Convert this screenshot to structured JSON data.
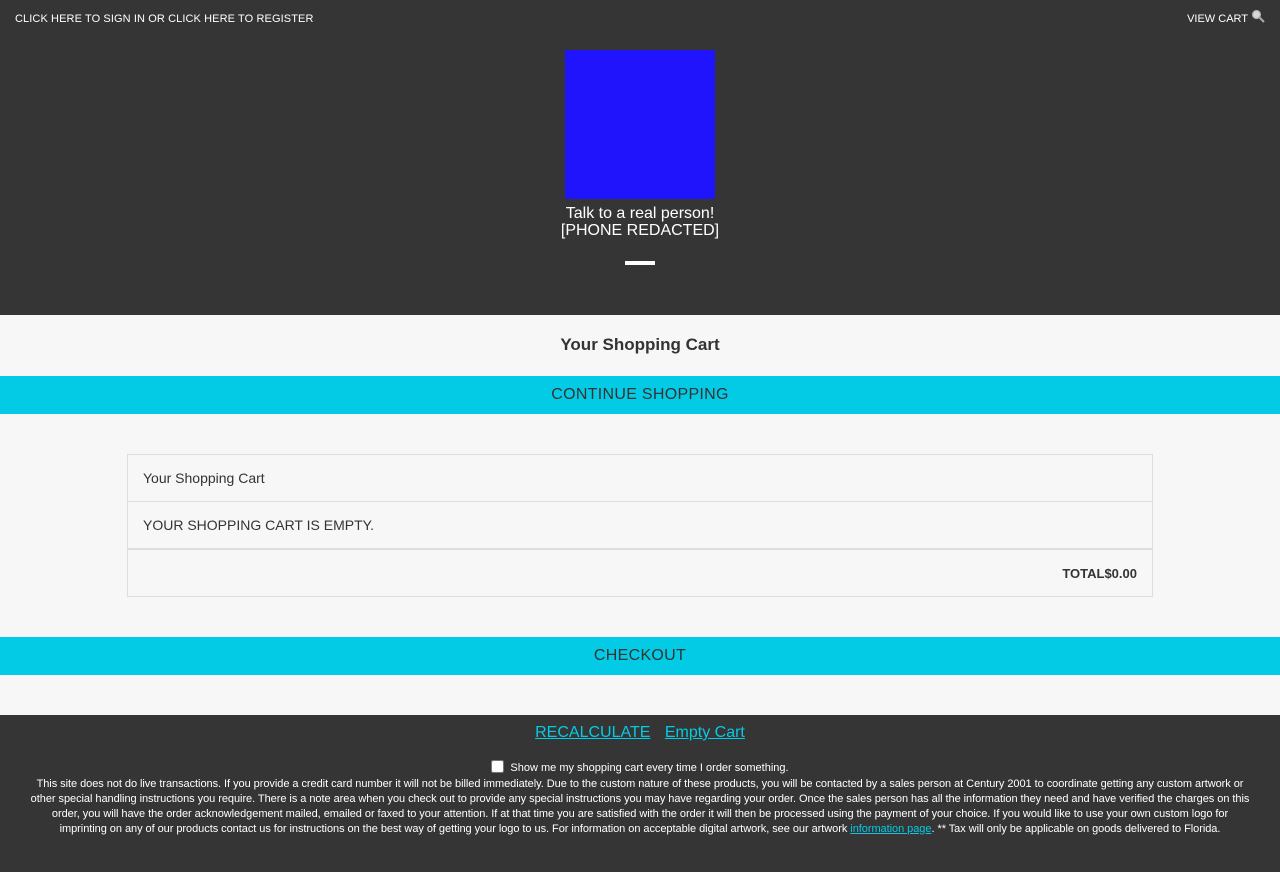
{
  "header": {
    "signin_prefix": "CLICK HERE TO SIGN IN",
    "signin_or": " OR ",
    "register": "CLICK HERE TO REGISTER",
    "view_cart": "VIEW CART",
    "search_icon": "search-icon",
    "logo_color": "#1f14fb",
    "talk_line1": "Talk to a real person!",
    "talk_line2": "[PHONE REDACTED]"
  },
  "main": {
    "title": "Your Shopping Cart",
    "continue_label": "CONTINUE SHOPPING",
    "checkout_label": "CHECKOUT",
    "accent_color": "#04cbe5"
  },
  "cart_table": {
    "caption": "Your Shopping Cart",
    "empty_message": "YOUR SHOPPING CART IS EMPTY.",
    "total_label": "TOTAL",
    "total_value": "$0.00"
  },
  "footer": {
    "recalculate": "RECALCULATE",
    "empty_cart": "Empty Cart",
    "show_cart_label": "Show me my shopping cart every time I order something.",
    "show_cart_checked": false,
    "disclaimer_text": "This site does not do live transactions. If you provide a credit card number it will not be billed immediately. Due to the custom nature of these products, you will be contacted by a sales person at Century 2001 to coordinate getting any custom artwork or other special handling instructions you require. There is a note area when you check out to provide any special instructions you may have regarding your order. Once the sales person has all the information they need and have verified the charges on this order, you will have the order acknowledgement mailed, emailed or faxed to your attention. If at that time you are satisfied with the order it will then be processed using the payment of your choice. If you would like to use your own custom logo for imprinting on any of our products contact us for instructions on the best way of getting your logo to us. For information on acceptable digital artwork, see our artwork ",
    "info_link": "information page",
    "disclaimer_tail": ". ** Tax will only be applicable on goods delivered to Florida."
  }
}
